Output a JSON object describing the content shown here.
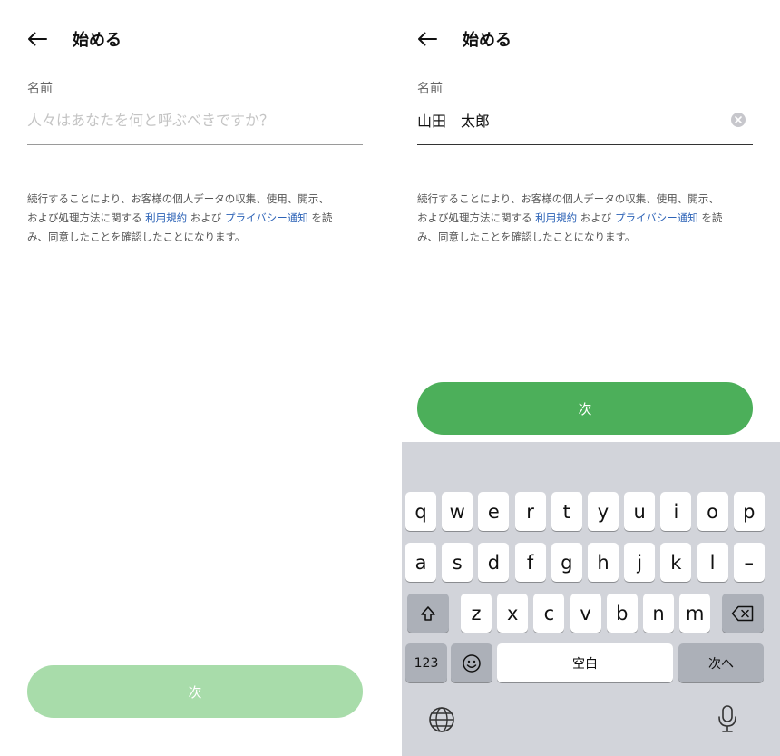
{
  "screens": [
    {
      "title": "始める",
      "name_label": "名前",
      "name_value": "",
      "name_placeholder": "人々はあなたを何と呼ぶべきですか？",
      "consent": {
        "line1": "続行することにより、お客様の個人データの収集、使用、開示、",
        "line2_pre": "および処理方法に関する ",
        "terms_link": "利用規約",
        "and": " および ",
        "privacy_link": "プライバシー通知",
        "line2_post": " を読",
        "line3": "み、同意したことを確認したことになります。"
      },
      "next_label": "次",
      "next_state": "disabled"
    },
    {
      "title": "始める",
      "name_label": "名前",
      "name_value": "山田　太郎",
      "consent": {
        "line1": "続行することにより、お客様の個人データの収集、使用、開示、",
        "line2_pre": "および処理方法に関する ",
        "terms_link": "利用規約",
        "and": " および ",
        "privacy_link": "プライバシー通知",
        "line2_post": " を読",
        "line3": "み、同意したことを確認したことになります。"
      },
      "next_label": "次",
      "next_state": "enabled"
    }
  ],
  "keyboard": {
    "row1": [
      "q",
      "w",
      "e",
      "r",
      "t",
      "y",
      "u",
      "i",
      "o",
      "p"
    ],
    "row2": [
      "a",
      "s",
      "d",
      "f",
      "g",
      "h",
      "j",
      "k",
      "l",
      "–"
    ],
    "row3": [
      "z",
      "x",
      "c",
      "v",
      "b",
      "n",
      "m"
    ],
    "numbers_key": "123",
    "space_key": "空白",
    "return_key": "次へ",
    "icons": [
      "shift-icon",
      "delete-icon",
      "emoji-icon",
      "globe-icon",
      "microphone-icon"
    ]
  },
  "colors": {
    "button_enabled": "#4caf5a",
    "button_disabled": "#a8dcaa",
    "link": "#2d63b7",
    "keyboard_bg": "#d2d4da",
    "fn_key": "#acb0b8"
  }
}
